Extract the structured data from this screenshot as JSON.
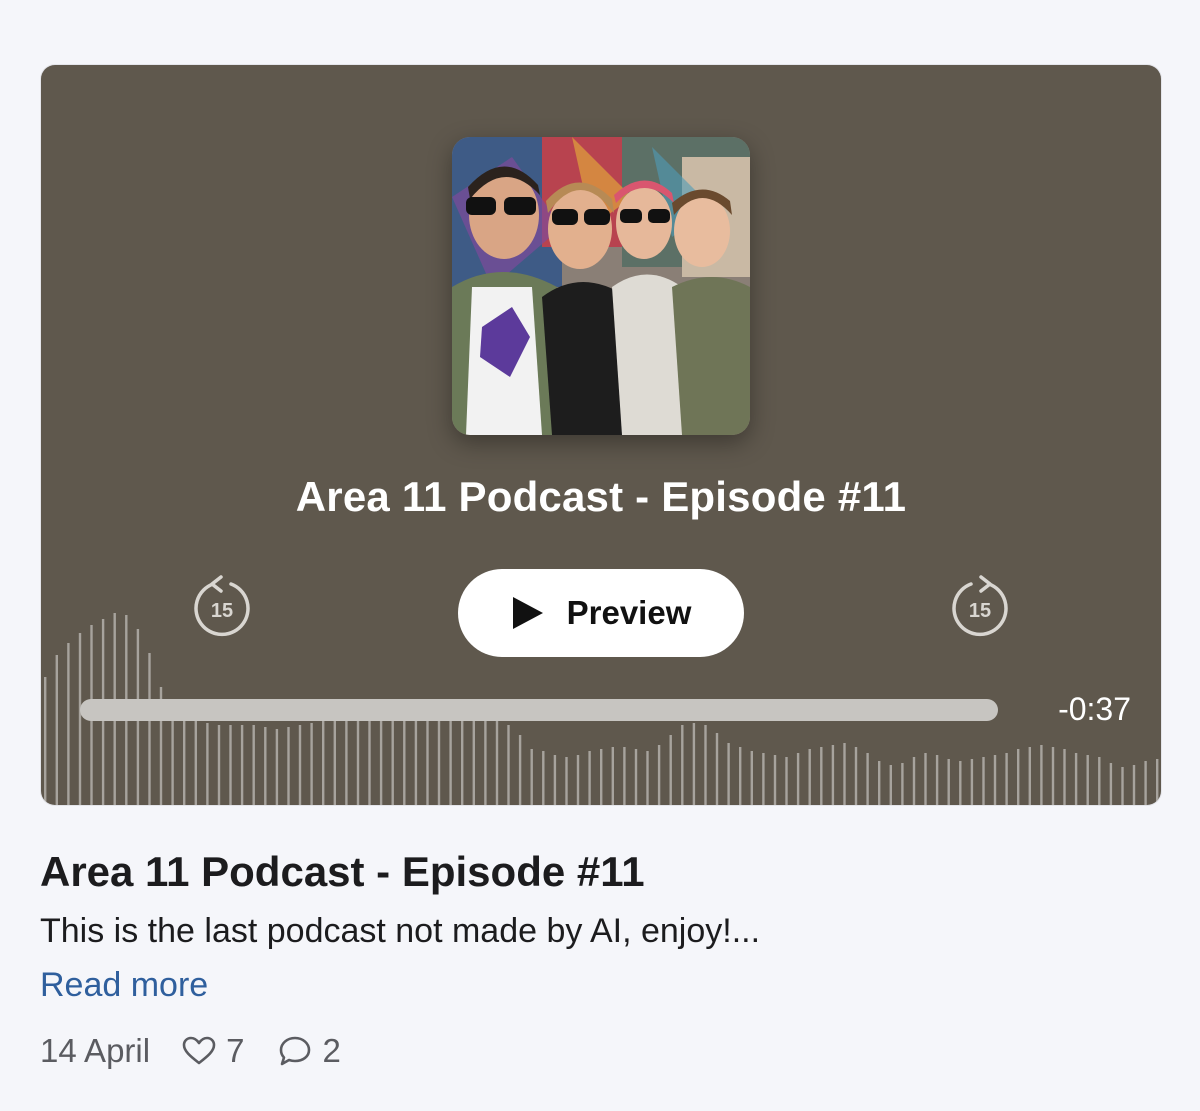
{
  "player": {
    "title": "Area 11 Podcast - Episode #11",
    "preview_label": "Preview",
    "skip_back_seconds": "15",
    "skip_forward_seconds": "15",
    "time_remaining": "-0:37",
    "progress": 0.0,
    "play_icon": "play-icon",
    "skip_back_icon": "rewind-15-icon",
    "skip_forward_icon": "forward-15-icon",
    "background_color": "#5f584d"
  },
  "episode": {
    "title": "Area 11 Podcast - Episode #11",
    "description": "This is the last podcast not made by AI, enjoy!...",
    "read_more_label": "Read more",
    "date": "14 April",
    "likes": "7",
    "comments": "2",
    "like_icon": "heart-icon",
    "comment_icon": "comment-bubble-icon",
    "link_color": "#2f5f9d"
  }
}
